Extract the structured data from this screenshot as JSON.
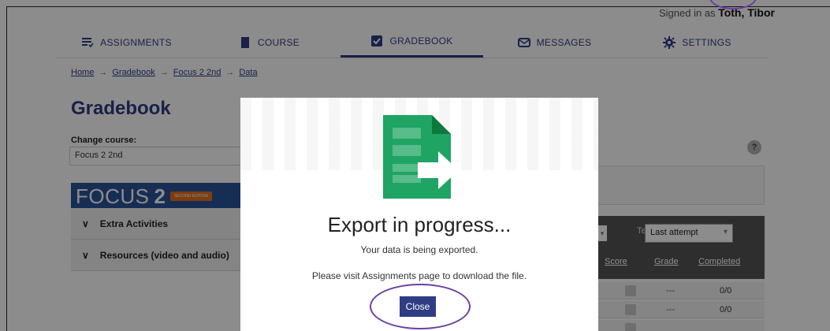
{
  "header": {
    "signed_in_prefix": "Signed in as",
    "user_name": "Toth, Tibor"
  },
  "nav": {
    "tabs": [
      {
        "label": "ASSIGNMENTS",
        "icon": "assignments-icon",
        "active": false
      },
      {
        "label": "COURSE",
        "icon": "book-icon",
        "active": false
      },
      {
        "label": "GRADEBOOK",
        "icon": "gradebook-checkbox-icon",
        "active": true
      },
      {
        "label": "MESSAGES",
        "icon": "messages-icon",
        "active": false
      },
      {
        "label": "SETTINGS",
        "icon": "gear-icon",
        "active": false
      }
    ]
  },
  "breadcrumb": {
    "items": [
      "Home",
      "Gradebook",
      "Focus 2 2nd",
      "Data"
    ],
    "separator": "→"
  },
  "page": {
    "title": "Gradebook",
    "change_course_label": "Change course:",
    "course_value": "Focus 2 2nd",
    "help_label": "?"
  },
  "banner": {
    "word": "FOCUS",
    "number": "2",
    "edition": "SECOND EDITION"
  },
  "accordion": [
    "Extra Activities",
    "Resources (video and audio)"
  ],
  "table": {
    "tests_label": "Tests",
    "attempt_value": "Last attempt",
    "columns": [
      "Score",
      "Grade",
      "Completed"
    ],
    "rows": [
      {
        "grade": "---",
        "completed": "0/0"
      },
      {
        "grade": "---",
        "completed": "0/0"
      }
    ]
  },
  "modal": {
    "title": "Export in progress...",
    "message": "Your data is being exported.",
    "instruction": "Please visit Assignments page to download the file.",
    "close_label": "Close",
    "icon": "spreadsheet-export-icon"
  },
  "colors": {
    "brand": "#2f3d85",
    "export_icon": "#1fa463",
    "annotation": "#6b3fa0"
  }
}
